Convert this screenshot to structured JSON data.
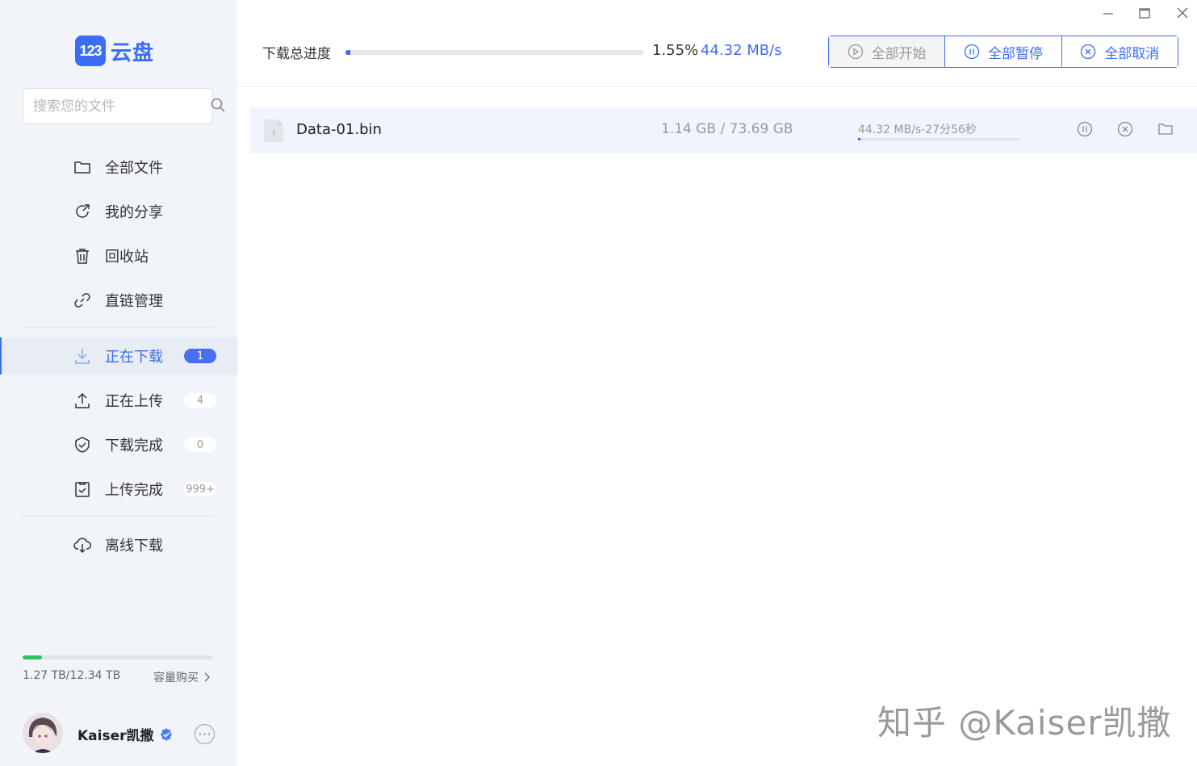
{
  "app": {
    "logo_badge": "123",
    "logo_text": "云盘"
  },
  "search": {
    "placeholder": "搜索您的文件"
  },
  "sidebar": {
    "items": [
      {
        "label": "全部文件",
        "icon": "folder-icon"
      },
      {
        "label": "我的分享",
        "icon": "share-icon"
      },
      {
        "label": "回收站",
        "icon": "trash-icon"
      },
      {
        "label": "直链管理",
        "icon": "link-icon"
      },
      {
        "label": "正在下载",
        "icon": "download-icon",
        "badge": "1",
        "active": true
      },
      {
        "label": "正在上传",
        "icon": "upload-icon",
        "badge": "4"
      },
      {
        "label": "下载完成",
        "icon": "check-shield-icon",
        "badge": "0"
      },
      {
        "label": "上传完成",
        "icon": "check-document-icon",
        "badge": "999+"
      },
      {
        "label": "离线下载",
        "icon": "cloud-download-icon"
      }
    ]
  },
  "storage": {
    "text": "1.27 TB/12.34 TB",
    "used_fraction": 0.103,
    "buy_label": "容量购买"
  },
  "user": {
    "name": "Kaiser凯撒"
  },
  "header": {
    "progress_label": "下载总进度",
    "progress_fraction": 0.0155,
    "progress_pct": "1.55%",
    "speed": "44.32 MB/s",
    "buttons": {
      "start_all": "全部开始",
      "pause_all": "全部暂停",
      "cancel_all": "全部取消"
    }
  },
  "downloads": [
    {
      "name": "Data-01.bin",
      "size": "1.14 GB / 73.69 GB",
      "speed_eta": "44.32 MB/s-27分56秒",
      "progress_fraction": 0.0155
    }
  ],
  "watermark": "知乎 @Kaiser凯撒",
  "colors": {
    "accent": "#3b6ef5",
    "storage": "#2fc25b",
    "sidebar_bg": "#f1f4f9"
  }
}
